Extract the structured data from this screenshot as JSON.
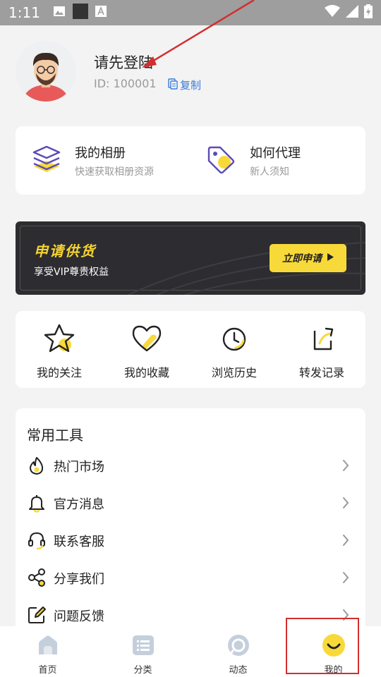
{
  "status_bar": {
    "time": "1:11"
  },
  "profile": {
    "username": "请先登陆",
    "id_text": "ID: 100001",
    "copy_label": "复制"
  },
  "quick_links": [
    {
      "title": "我的相册",
      "subtitle": "快速获取相册资源",
      "icon": "album-stack-icon"
    },
    {
      "title": "如何代理",
      "subtitle": "新人须知",
      "icon": "price-tag-icon"
    }
  ],
  "banner": {
    "title": "申请供货",
    "subtitle": "享受VIP尊贵权益",
    "button_label": "立即申请"
  },
  "shortcuts": [
    {
      "label": "我的关注",
      "icon": "star-icon"
    },
    {
      "label": "我的收藏",
      "icon": "heart-icon"
    },
    {
      "label": "浏览历史",
      "icon": "clock-icon"
    },
    {
      "label": "转发记录",
      "icon": "share-forward-icon"
    }
  ],
  "tools": {
    "title": "常用工具",
    "items": [
      {
        "label": "热门市场",
        "icon": "flame-icon"
      },
      {
        "label": "官方消息",
        "icon": "bell-icon"
      },
      {
        "label": "联系客服",
        "icon": "headset-icon"
      },
      {
        "label": "分享我们",
        "icon": "share-nodes-icon"
      },
      {
        "label": "问题反馈",
        "icon": "edit-feedback-icon"
      }
    ]
  },
  "tab_bar": {
    "tabs": [
      {
        "label": "首页",
        "icon": "home-icon"
      },
      {
        "label": "分类",
        "icon": "category-list-icon"
      },
      {
        "label": "动态",
        "icon": "moments-icon"
      },
      {
        "label": "我的",
        "icon": "smile-face-icon",
        "active": true
      }
    ]
  },
  "colors": {
    "accent_yellow": "#f8d93a",
    "icon_purple": "#5b4bb7",
    "link_blue": "#3a7bd5",
    "banner_dark": "#2c2c31",
    "annotation_red": "#d32f2f"
  }
}
